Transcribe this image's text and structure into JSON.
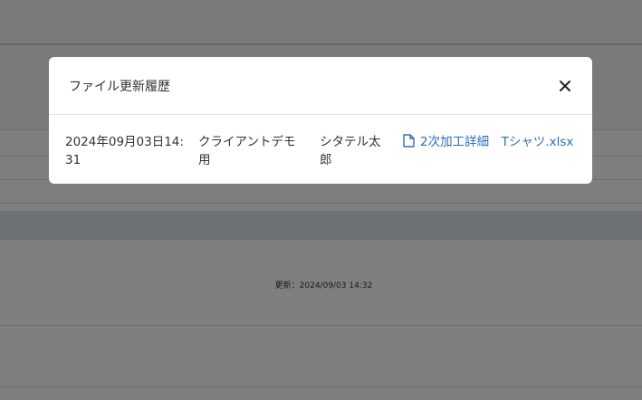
{
  "background": {
    "updated_text": "更新：2024/09/03 14:32"
  },
  "modal": {
    "title": "ファイル更新履歴",
    "close_icon": "close-icon",
    "history": [
      {
        "datetime": "2024年09月03日14:31",
        "client": "クライアントデモ用",
        "user": "シタテル太郎",
        "file_icon": "file-icon",
        "file_name": "2次加工詳細　Tシャツ.xlsx"
      }
    ]
  },
  "colors": {
    "link": "#2a6ebb",
    "overlay": "rgba(0,0,0,0.5)",
    "text": "#333333"
  }
}
